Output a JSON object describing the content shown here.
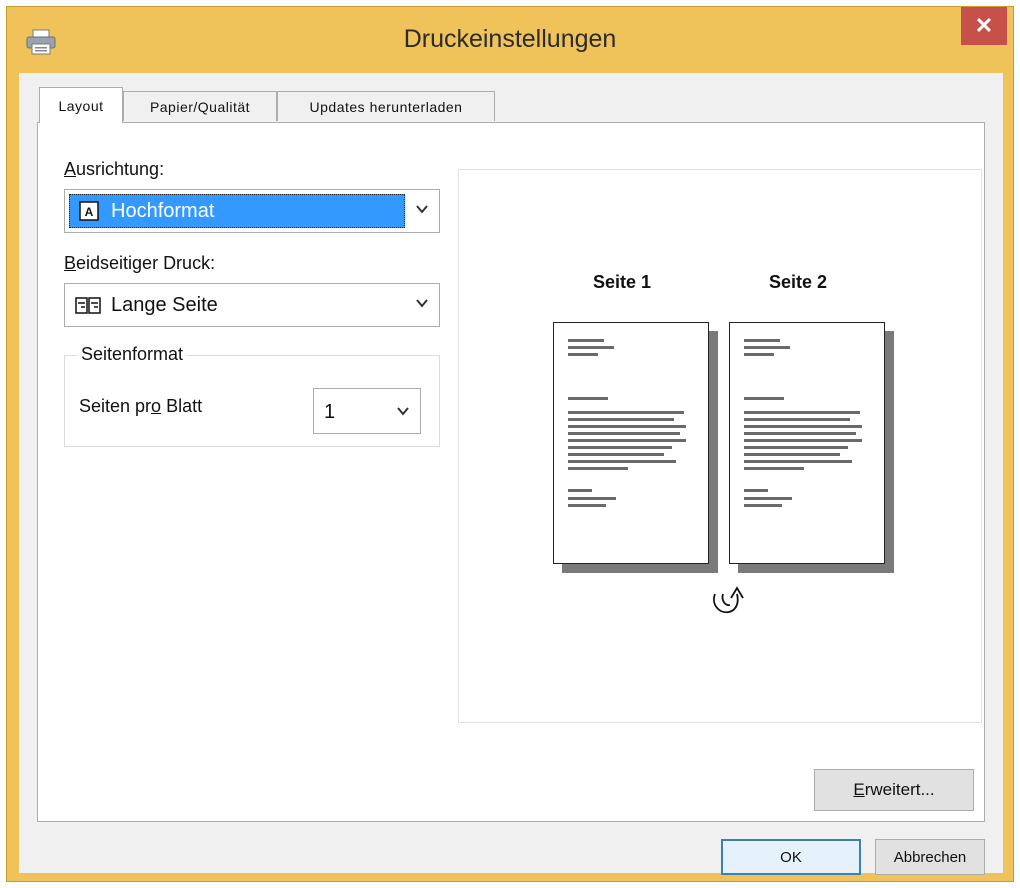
{
  "window": {
    "title": "Druckeinstellungen",
    "close_label": "✕",
    "icon": "printer-icon"
  },
  "tabs": [
    {
      "label": "Layout",
      "active": true
    },
    {
      "label": "Papier/Qualität",
      "active": false
    },
    {
      "label": "Updates herunterladen",
      "active": false
    }
  ],
  "layout": {
    "orientation": {
      "label_first": "A",
      "label_rest": "usrichtung:",
      "value": "Hochformat",
      "icon": "portrait-page-icon"
    },
    "duplex": {
      "label_first": "B",
      "label_rest": "eidseitiger Druck:",
      "value": "Lange Seite",
      "icon": "book-long-edge-icon"
    },
    "page_format": {
      "group_title": "Seitenformat",
      "pages_per_sheet_label_a": "Seiten pr",
      "pages_per_sheet_label_u": "o",
      "pages_per_sheet_label_b": " Blatt",
      "pages_per_sheet_value": "1"
    },
    "preview": {
      "page1_label": "Seite 1",
      "page2_label": "Seite 2",
      "flip_icon": "flip-arrow-icon"
    }
  },
  "buttons": {
    "advanced_first": "E",
    "advanced_rest": "rweitert...",
    "ok": "OK",
    "cancel": "Abbrechen"
  },
  "colors": {
    "titlebar": "#f0c35a",
    "close": "#c7504a",
    "selection": "#3399ff"
  }
}
